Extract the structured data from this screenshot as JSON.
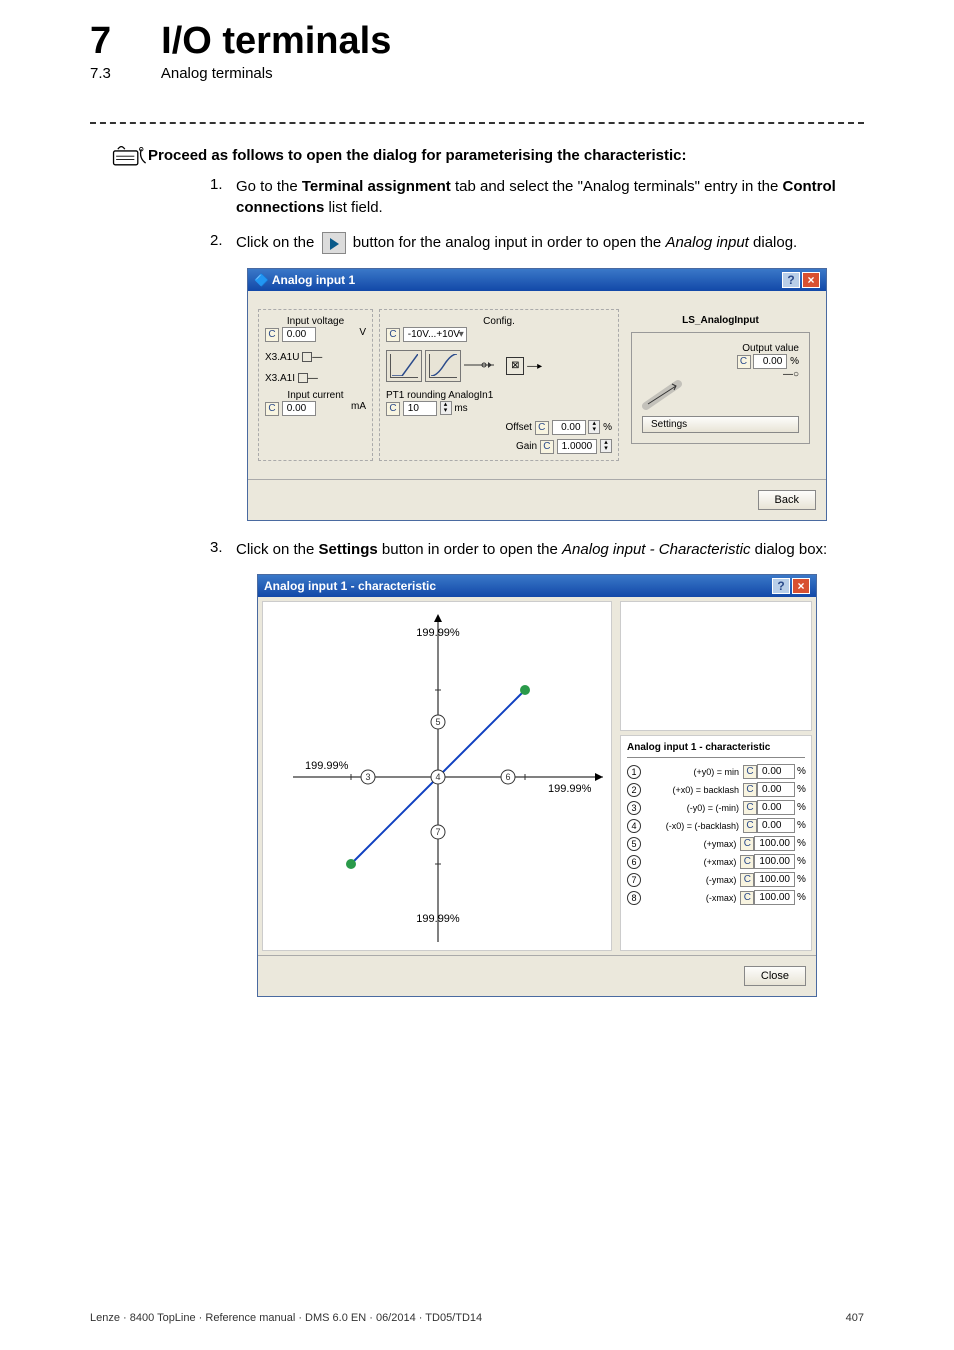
{
  "chapter": {
    "num": "7",
    "title": "I/O terminals",
    "subnum": "7.3",
    "subtitle": "Analog terminals"
  },
  "instr": {
    "lead": "Proceed as follows to open the dialog for parameterising the characteristic:",
    "step1_num": "1.",
    "step1_a": "Go to the ",
    "step1_b": "Terminal assignment",
    "step1_c": " tab and select the \"Analog terminals\" entry in the ",
    "step1_d": "Control connections",
    "step1_e": " list field.",
    "step2_num": "2.",
    "step2_a": "Click on the ",
    "step2_b": " button for the analog input in order to open the ",
    "step2_c": "Analog input",
    "step2_d": " dialog.",
    "step3_num": "3.",
    "step3_a": "Click on the ",
    "step3_b": "Settings",
    "step3_c": " button in order to open the ",
    "step3_d": "Analog input - Characteristic",
    "step3_e": " dialog box:"
  },
  "dialog1": {
    "title": "Analog input 1",
    "left": {
      "lbl_voltage": "Input voltage",
      "v_val": "0.00",
      "v_unit": "V",
      "x3a1u": "X3.A1U",
      "x3a1i": "X3.A1I",
      "lbl_current": "Input current",
      "i_val": "0.00",
      "i_unit": "mA"
    },
    "mid": {
      "config": "Config.",
      "config_val": "-10V...+10V",
      "pt1": "PT1 rounding AnalogIn1",
      "pt1_val": "10",
      "pt1_unit": "ms",
      "offset": "Offset",
      "offset_val": "0.00",
      "offset_unit": "%",
      "gain": "Gain",
      "gain_val": "1.0000"
    },
    "right": {
      "block": "LS_AnalogInput",
      "out_label": "Output value",
      "out_val": "0.00",
      "out_unit": "%",
      "settings": "Settings"
    },
    "back": "Back"
  },
  "dialog2": {
    "title": "Analog input 1 - characteristic",
    "params_title": "Analog input 1 - characteristic",
    "rows": [
      {
        "n": "1",
        "lbl": "(+y0) = min",
        "v": "0.00",
        "u": "%"
      },
      {
        "n": "2",
        "lbl": "(+x0) = backlash",
        "v": "0.00",
        "u": "%"
      },
      {
        "n": "3",
        "lbl": "(-y0) = (-min)",
        "v": "0.00",
        "u": "%"
      },
      {
        "n": "4",
        "lbl": "(-x0) = (-backlash)",
        "v": "0.00",
        "u": "%"
      },
      {
        "n": "5",
        "lbl": "(+ymax)",
        "v": "100.00",
        "u": "%"
      },
      {
        "n": "6",
        "lbl": "(+xmax)",
        "v": "100.00",
        "u": "%"
      },
      {
        "n": "7",
        "lbl": "(-ymax)",
        "v": "100.00",
        "u": "%"
      },
      {
        "n": "8",
        "lbl": "(-xmax)",
        "v": "100.00",
        "u": "%"
      }
    ],
    "close": "Close"
  },
  "chart_data": {
    "type": "line",
    "xlim": [
      -199.99,
      199.99
    ],
    "ylim": [
      -199.99,
      199.99
    ],
    "ticks_x": [
      "199.99%",
      "199.99%"
    ],
    "ticks_y": [
      "199.99%",
      "199.99%"
    ],
    "labels": {
      "y_top": "199.99%",
      "y_bottom": "199.99%",
      "x_left": "199.99%",
      "x_right": "199.99%"
    },
    "markers": [
      {
        "id": 3,
        "x": -100,
        "y": 0
      },
      {
        "id": 4,
        "x": 0,
        "y": 0
      },
      {
        "id": 5,
        "x": 0,
        "y": 100
      },
      {
        "id": 6,
        "x": 100,
        "y": 0
      },
      {
        "id": 7,
        "x": 0,
        "y": -100
      }
    ],
    "series": [
      {
        "name": "characteristic",
        "x": [
          -100,
          100
        ],
        "y": [
          -100,
          100
        ]
      }
    ]
  },
  "footer": {
    "left": "Lenze · 8400 TopLine · Reference manual · DMS 6.0 EN · 06/2014 · TD05/TD14",
    "right": "407"
  }
}
